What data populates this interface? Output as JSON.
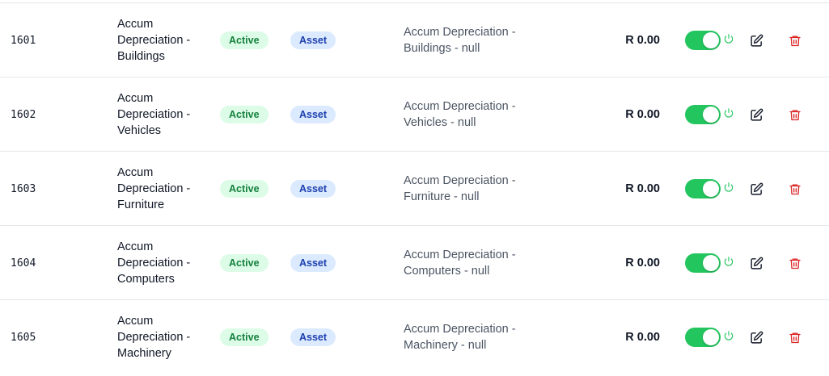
{
  "colors": {
    "active_bg": "#dcfce7",
    "active_text": "#15803d",
    "type_bg": "#dbeafe",
    "type_text": "#1e40af",
    "toggle_on": "#22c55e",
    "power_icon": "#22c55e",
    "delete_icon": "#dc2626",
    "edit_icon": "#111827"
  },
  "icons": {
    "toggle": "toggle-switch",
    "power": "power-icon",
    "edit": "edit-pencil-icon",
    "delete": "trash-icon"
  },
  "rows": [
    {
      "code": "1601",
      "name_lines": [
        "Accum",
        "Depreciation -",
        "Buildings"
      ],
      "status": "Active",
      "type": "Asset",
      "desc_lines": [
        "Accum Depreciation -",
        "Buildings - null"
      ],
      "balance": "R 0.00",
      "enabled": true
    },
    {
      "code": "1602",
      "name_lines": [
        "Accum",
        "Depreciation -",
        "Vehicles"
      ],
      "status": "Active",
      "type": "Asset",
      "desc_lines": [
        "Accum Depreciation -",
        "Vehicles - null"
      ],
      "balance": "R 0.00",
      "enabled": true
    },
    {
      "code": "1603",
      "name_lines": [
        "Accum",
        "Depreciation -",
        "Furniture"
      ],
      "status": "Active",
      "type": "Asset",
      "desc_lines": [
        "Accum Depreciation -",
        "Furniture - null"
      ],
      "balance": "R 0.00",
      "enabled": true
    },
    {
      "code": "1604",
      "name_lines": [
        "Accum",
        "Depreciation -",
        "Computers"
      ],
      "status": "Active",
      "type": "Asset",
      "desc_lines": [
        "Accum Depreciation -",
        "Computers - null"
      ],
      "balance": "R 0.00",
      "enabled": true
    },
    {
      "code": "1605",
      "name_lines": [
        "Accum",
        "Depreciation -",
        "Machinery"
      ],
      "status": "Active",
      "type": "Asset",
      "desc_lines": [
        "Accum Depreciation -",
        "Machinery - null"
      ],
      "balance": "R 0.00",
      "enabled": true
    }
  ]
}
